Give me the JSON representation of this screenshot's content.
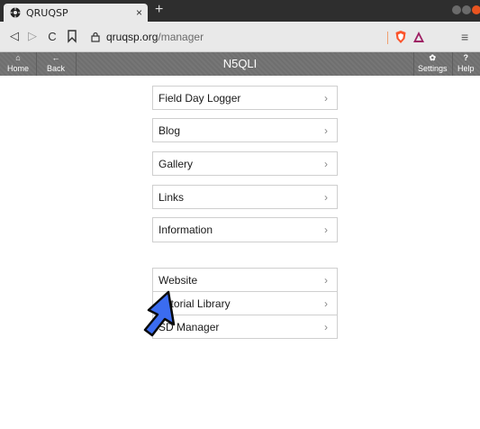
{
  "browser": {
    "tab_title": "QRUQSP",
    "tab_close": "×",
    "new_tab": "+",
    "url_host": "qruqsp.org",
    "url_path": "/manager",
    "menu_glyph": "≡"
  },
  "header": {
    "title": "N5QLI",
    "home_label": "Home",
    "back_label": "Back",
    "settings_label": "Settings",
    "help_label": "Help",
    "home_icon": "home-icon",
    "back_icon": "back-arrow-icon",
    "settings_icon": "gear-icon",
    "help_icon": "question-icon"
  },
  "menu_primary": [
    {
      "label": "Field Day Logger",
      "chevron": "›"
    },
    {
      "label": "Blog",
      "chevron": "›"
    },
    {
      "label": "Gallery",
      "chevron": "›"
    },
    {
      "label": "Links",
      "chevron": "›"
    },
    {
      "label": "Information",
      "chevron": "›"
    }
  ],
  "menu_secondary": [
    {
      "label": "Website",
      "chevron": "›"
    },
    {
      "label": "Tutorial Library",
      "chevron": "›"
    },
    {
      "label": "SD Manager",
      "chevron": "›"
    }
  ],
  "colors": {
    "header_bg": "#727272",
    "accent_close": "#e95420",
    "cursor_fill": "#3b6cf0"
  }
}
